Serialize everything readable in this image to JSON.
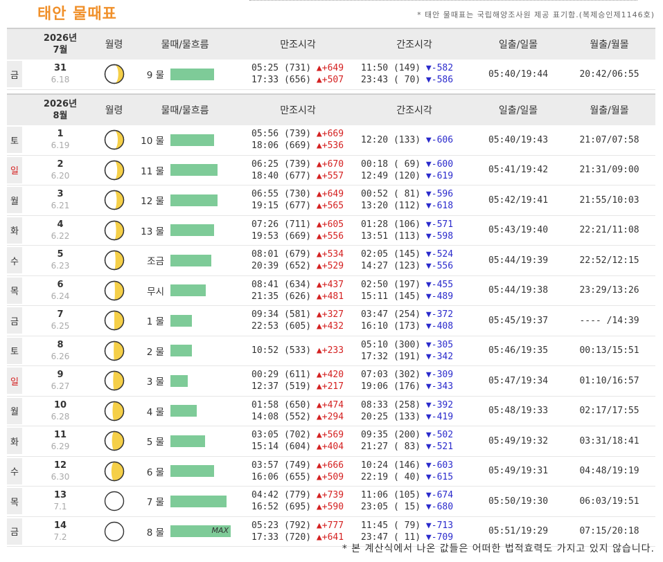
{
  "title": "태안 물때표",
  "notice": "* 태안 물때표는 국립해양조사원 제공 표기함.(복제승인제1146호)",
  "footer": "* 본 계산식에서 나온 값들은 어떠한 법적효력도 가지고 있지 않습니다.",
  "headers": {
    "moon": "월령",
    "tide": "물때/물흐름",
    "high": "만조시각",
    "low": "간조시각",
    "sun": "일출/일몰",
    "moonrise": "월출/월몰"
  },
  "bar_color": "#7ecb98",
  "colors": {
    "up": "#d42020",
    "down": "#2a2acc",
    "moon": "#f5cf48"
  },
  "sections": [
    {
      "year": "2026년",
      "month": "7월",
      "rows": [
        {
          "dow": "금",
          "red": false,
          "day": "31",
          "lunar": "6.18",
          "phase": 0.18,
          "tide": "9 물",
          "flow": 0.58,
          "max": "",
          "hi": [
            {
              "t": "05:25 (731)",
              "d": "+649"
            },
            {
              "t": "17:33 (656)",
              "d": "+507"
            }
          ],
          "lo": [
            {
              "t": "11:50 (149)",
              "d": "-582"
            },
            {
              "t": "23:43 ( 70)",
              "d": "-586"
            }
          ],
          "sun": "05:40/19:44",
          "moon": "20:42/06:55"
        }
      ]
    },
    {
      "year": "2026년",
      "month": "8월",
      "rows": [
        {
          "dow": "토",
          "red": false,
          "day": "1",
          "lunar": "6.19",
          "phase": 0.19,
          "tide": "10 물",
          "flow": 0.58,
          "max": "",
          "hi": [
            {
              "t": "05:56 (739)",
              "d": "+669"
            },
            {
              "t": "18:06 (669)",
              "d": "+536"
            }
          ],
          "lo": [
            {
              "t": "12:20 (133)",
              "d": "-606"
            }
          ],
          "sun": "05:40/19:43",
          "moon": "21:07/07:58"
        },
        {
          "dow": "일",
          "red": true,
          "day": "2",
          "lunar": "6.20",
          "phase": 0.2,
          "tide": "11 물",
          "flow": 0.63,
          "max": "",
          "hi": [
            {
              "t": "06:25 (739)",
              "d": "+670"
            },
            {
              "t": "18:40 (677)",
              "d": "+557"
            }
          ],
          "lo": [
            {
              "t": "00:18 ( 69)",
              "d": "-600"
            },
            {
              "t": "12:49 (120)",
              "d": "-619"
            }
          ],
          "sun": "05:41/19:42",
          "moon": "21:31/09:00"
        },
        {
          "dow": "월",
          "red": false,
          "day": "3",
          "lunar": "6.21",
          "phase": 0.21,
          "tide": "12 물",
          "flow": 0.63,
          "max": "",
          "hi": [
            {
              "t": "06:55 (730)",
              "d": "+649"
            },
            {
              "t": "19:15 (677)",
              "d": "+565"
            }
          ],
          "lo": [
            {
              "t": "00:52 ( 81)",
              "d": "-596"
            },
            {
              "t": "13:20 (112)",
              "d": "-618"
            }
          ],
          "sun": "05:42/19:41",
          "moon": "21:55/10:03"
        },
        {
          "dow": "화",
          "red": false,
          "day": "4",
          "lunar": "6.22",
          "phase": 0.22,
          "tide": "13 물",
          "flow": 0.58,
          "max": "",
          "hi": [
            {
              "t": "07:26 (711)",
              "d": "+605"
            },
            {
              "t": "19:53 (669)",
              "d": "+556"
            }
          ],
          "lo": [
            {
              "t": "01:28 (106)",
              "d": "-571"
            },
            {
              "t": "13:51 (113)",
              "d": "-598"
            }
          ],
          "sun": "05:43/19:40",
          "moon": "22:21/11:08"
        },
        {
          "dow": "수",
          "red": false,
          "day": "5",
          "lunar": "6.23",
          "phase": 0.23,
          "tide": "조금",
          "flow": 0.55,
          "max": "",
          "hi": [
            {
              "t": "08:01 (679)",
              "d": "+534"
            },
            {
              "t": "20:39 (652)",
              "d": "+529"
            }
          ],
          "lo": [
            {
              "t": "02:05 (145)",
              "d": "-524"
            },
            {
              "t": "14:27 (123)",
              "d": "-556"
            }
          ],
          "sun": "05:44/19:39",
          "moon": "22:52/12:15"
        },
        {
          "dow": "목",
          "red": false,
          "day": "6",
          "lunar": "6.24",
          "phase": 0.24,
          "tide": "무시",
          "flow": 0.47,
          "max": "",
          "hi": [
            {
              "t": "08:41 (634)",
              "d": "+437"
            },
            {
              "t": "21:35 (626)",
              "d": "+481"
            }
          ],
          "lo": [
            {
              "t": "02:50 (197)",
              "d": "-455"
            },
            {
              "t": "15:11 (145)",
              "d": "-489"
            }
          ],
          "sun": "05:44/19:38",
          "moon": "23:29/13:26"
        },
        {
          "dow": "금",
          "red": false,
          "day": "7",
          "lunar": "6.25",
          "phase": 0.25,
          "tide": "1 물",
          "flow": 0.29,
          "max": "",
          "hi": [
            {
              "t": "09:34 (581)",
              "d": "+327"
            },
            {
              "t": "22:53 (605)",
              "d": "+432"
            }
          ],
          "lo": [
            {
              "t": "03:47 (254)",
              "d": "-372"
            },
            {
              "t": "16:10 (173)",
              "d": "-408"
            }
          ],
          "sun": "05:45/19:37",
          "moon": "---- /14:39"
        },
        {
          "dow": "토",
          "red": false,
          "day": "8",
          "lunar": "6.26",
          "phase": 0.26,
          "tide": "2 물",
          "flow": 0.29,
          "max": "",
          "hi": [
            {
              "t": "10:52 (533)",
              "d": "+233"
            }
          ],
          "lo": [
            {
              "t": "05:10 (300)",
              "d": "-305"
            },
            {
              "t": "17:32 (191)",
              "d": "-342"
            }
          ],
          "sun": "05:46/19:35",
          "moon": "00:13/15:51"
        },
        {
          "dow": "일",
          "red": true,
          "day": "9",
          "lunar": "6.27",
          "phase": 0.27,
          "tide": "3 물",
          "flow": 0.23,
          "max": "",
          "hi": [
            {
              "t": "00:29 (611)",
              "d": "+420"
            },
            {
              "t": "12:37 (519)",
              "d": "+217"
            }
          ],
          "lo": [
            {
              "t": "07:03 (302)",
              "d": "-309"
            },
            {
              "t": "19:06 (176)",
              "d": "-343"
            }
          ],
          "sun": "05:47/19:34",
          "moon": "01:10/16:57"
        },
        {
          "dow": "월",
          "red": false,
          "day": "10",
          "lunar": "6.28",
          "phase": 0.28,
          "tide": "4 물",
          "flow": 0.35,
          "max": "",
          "hi": [
            {
              "t": "01:58 (650)",
              "d": "+474"
            },
            {
              "t": "14:08 (552)",
              "d": "+294"
            }
          ],
          "lo": [
            {
              "t": "08:33 (258)",
              "d": "-392"
            },
            {
              "t": "20:25 (133)",
              "d": "-419"
            }
          ],
          "sun": "05:48/19:33",
          "moon": "02:17/17:55"
        },
        {
          "dow": "화",
          "red": false,
          "day": "11",
          "lunar": "6.29",
          "phase": 0.29,
          "tide": "5 물",
          "flow": 0.46,
          "max": "",
          "hi": [
            {
              "t": "03:05 (702)",
              "d": "+569"
            },
            {
              "t": "15:14 (604)",
              "d": "+404"
            }
          ],
          "lo": [
            {
              "t": "09:35 (200)",
              "d": "-502"
            },
            {
              "t": "21:27 ( 83)",
              "d": "-521"
            }
          ],
          "sun": "05:49/19:32",
          "moon": "03:31/18:41"
        },
        {
          "dow": "수",
          "red": false,
          "day": "12",
          "lunar": "6.30",
          "phase": 0.3,
          "tide": "6 물",
          "flow": 0.58,
          "max": "",
          "hi": [
            {
              "t": "03:57 (749)",
              "d": "+666"
            },
            {
              "t": "16:06 (655)",
              "d": "+509"
            }
          ],
          "lo": [
            {
              "t": "10:24 (146)",
              "d": "-603"
            },
            {
              "t": "22:19 ( 40)",
              "d": "-615"
            }
          ],
          "sun": "05:49/19:31",
          "moon": "04:48/19:19"
        },
        {
          "dow": "목",
          "red": false,
          "day": "13",
          "lunar": "7.1",
          "phase": 0.01,
          "tide": "7 물",
          "flow": 0.75,
          "max": "",
          "hi": [
            {
              "t": "04:42 (779)",
              "d": "+739"
            },
            {
              "t": "16:52 (695)",
              "d": "+590"
            }
          ],
          "lo": [
            {
              "t": "11:06 (105)",
              "d": "-674"
            },
            {
              "t": "23:05 ( 15)",
              "d": "-680"
            }
          ],
          "sun": "05:50/19:30",
          "moon": "06:03/19:51"
        },
        {
          "dow": "금",
          "red": false,
          "day": "14",
          "lunar": "7.2",
          "phase": 0.02,
          "tide": "8 물",
          "flow": 0.81,
          "max": "MAX",
          "hi": [
            {
              "t": "05:23 (792)",
              "d": "+777"
            },
            {
              "t": "17:33 (720)",
              "d": "+641"
            }
          ],
          "lo": [
            {
              "t": "11:45 ( 79)",
              "d": "-713"
            },
            {
              "t": "23:47 ( 11)",
              "d": "-709"
            }
          ],
          "sun": "05:51/19:29",
          "moon": "07:15/20:18"
        }
      ]
    }
  ]
}
